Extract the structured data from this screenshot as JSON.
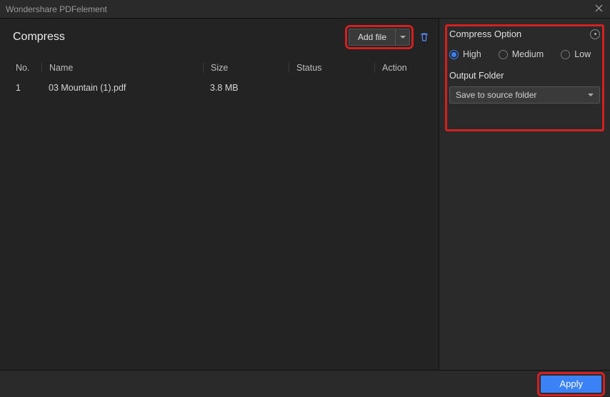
{
  "app_title": "Wondershare PDFelement",
  "page_title": "Compress",
  "toolbar": {
    "add_file_label": "Add file"
  },
  "table": {
    "headers": {
      "no": "No.",
      "name": "Name",
      "size": "Size",
      "status": "Status",
      "action": "Action"
    },
    "rows": [
      {
        "no": "1",
        "name": "03 Mountain (1).pdf",
        "size": "3.8 MB",
        "status": "",
        "action": ""
      }
    ]
  },
  "sidebar": {
    "option_title": "Compress Option",
    "levels": [
      "High",
      "Medium",
      "Low"
    ],
    "selected_level": "High",
    "output_label": "Output Folder",
    "output_value": "Save to source folder"
  },
  "footer": {
    "apply_label": "Apply"
  }
}
